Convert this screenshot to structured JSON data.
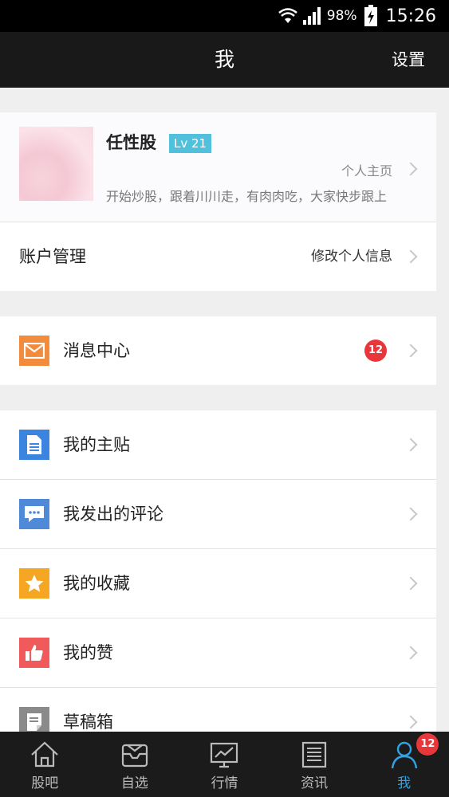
{
  "status_bar": {
    "battery": "98%",
    "time": "15:26"
  },
  "header": {
    "title": "我",
    "settings_label": "设置"
  },
  "profile": {
    "name": "任性股",
    "level": "Lv 21",
    "homepage_link": "个人主页",
    "bio": "开始炒股，跟着川川走，有肉肉吃，大家快步跟上"
  },
  "account": {
    "title": "账户管理",
    "action": "修改个人信息"
  },
  "messages": {
    "label": "消息中心",
    "badge": "12"
  },
  "menu": {
    "items": [
      {
        "label": "我的主贴",
        "icon": "document-icon",
        "color": "#3b84e0"
      },
      {
        "label": "我发出的评论",
        "icon": "comment-icon",
        "color": "#4f8ad8"
      },
      {
        "label": "我的收藏",
        "icon": "star-icon",
        "color": "#f5a623"
      },
      {
        "label": "我的赞",
        "icon": "thumbs-up-icon",
        "color": "#f05a5a"
      },
      {
        "label": "草稿箱",
        "icon": "draft-icon",
        "color": "#8a8a8a"
      }
    ]
  },
  "tabs": [
    {
      "label": "股吧",
      "icon": "home-icon"
    },
    {
      "label": "自选",
      "icon": "inbox-icon"
    },
    {
      "label": "行情",
      "icon": "chart-monitor-icon"
    },
    {
      "label": "资讯",
      "icon": "news-icon"
    },
    {
      "label": "我",
      "icon": "person-icon",
      "badge": "12",
      "active": true
    }
  ],
  "colors": {
    "accent": "#2ea3e6",
    "badge": "#e8373b",
    "level_badge": "#51c0dd",
    "mail_icon": "#f28b3c"
  }
}
